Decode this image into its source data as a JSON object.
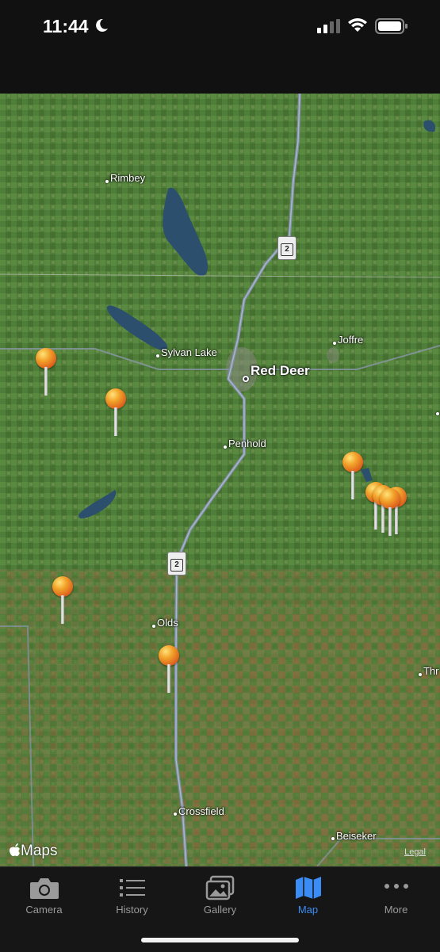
{
  "status": {
    "time": "11:44"
  },
  "map": {
    "labels": {
      "rimbey": "Rimbey",
      "sylvan_lake": "Sylvan Lake",
      "red_deer": "Red Deer",
      "joffre": "Joffre",
      "penhold": "Penhold",
      "olds": "Olds",
      "crossfield": "Crossfield",
      "beiseker": "Beiseker",
      "three_hills_partial": "Thr"
    },
    "highway_number": "2",
    "brand": "Maps",
    "legal": "Legal"
  },
  "tabs": [
    {
      "label": "Camera",
      "icon": "camera-icon",
      "active": false
    },
    {
      "label": "History",
      "icon": "list-icon",
      "active": false
    },
    {
      "label": "Gallery",
      "icon": "gallery-icon",
      "active": false
    },
    {
      "label": "Map",
      "icon": "map-icon",
      "active": true
    },
    {
      "label": "More",
      "icon": "more-icon",
      "active": false
    }
  ],
  "colors": {
    "accent": "#3b8cf5",
    "inactive": "#9a9a9a",
    "pin": "#e07a22"
  }
}
